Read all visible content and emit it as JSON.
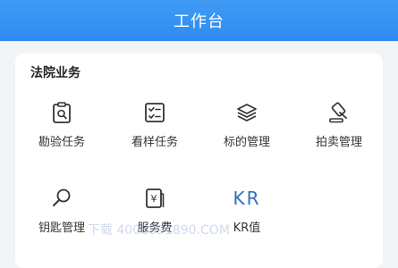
{
  "header": {
    "title": "工作台"
  },
  "section": {
    "title": "法院业务"
  },
  "items": [
    {
      "label": "勘验任务",
      "icon": "survey-clipboard-icon"
    },
    {
      "label": "看样任务",
      "icon": "sample-checklist-icon"
    },
    {
      "label": "标的管理",
      "icon": "layers-icon"
    },
    {
      "label": "拍卖管理",
      "icon": "gavel-icon"
    },
    {
      "label": "钥匙管理",
      "icon": "magnifier-key-icon"
    },
    {
      "label": "服务费",
      "icon": "yen-document-icon"
    },
    {
      "label": "KR值",
      "icon": "kr-icon",
      "icon_text": "KR"
    }
  ],
  "watermark": "下载 4008891890.COM",
  "colors": {
    "header": "#2f8cf0",
    "icon": "#333333",
    "kr_icon": "#2f6fbf",
    "background": "#f3f4f6"
  }
}
